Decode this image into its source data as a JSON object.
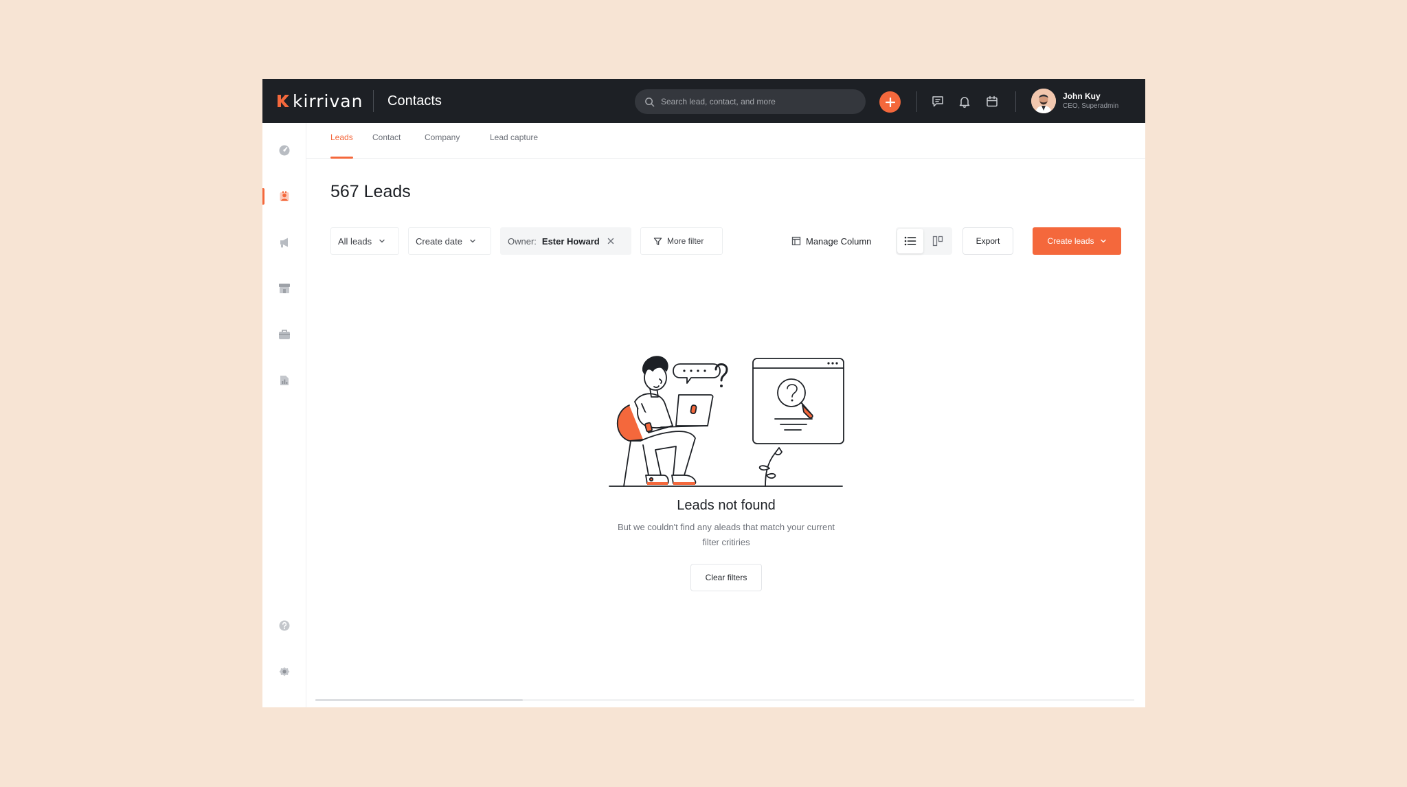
{
  "app": {
    "brand": "kirrivan",
    "page_title": "Contacts"
  },
  "search": {
    "placeholder": "Search lead, contact, and more"
  },
  "user": {
    "name": "John Kuy",
    "role": "CEO, Superadmin"
  },
  "tabs": [
    {
      "label": "Leads",
      "active": true
    },
    {
      "label": "Contact",
      "active": false
    },
    {
      "label": "Company",
      "active": false
    },
    {
      "label": "Lead capture",
      "active": false
    }
  ],
  "leads": {
    "title": "567 Leads"
  },
  "filters": {
    "all_leads": "All leads",
    "create_date": "Create date",
    "owner_label": "Owner:",
    "owner_value": "Ester Howard",
    "more_filter": "More filter"
  },
  "toolbar": {
    "manage_column": "Manage Column",
    "export": "Export",
    "create_leads": "Create leads"
  },
  "empty_state": {
    "title": "Leads not found",
    "description": "But we couldn't find any aleads that match your current filter critiries",
    "clear_filters": "Clear filters"
  },
  "colors": {
    "accent": "#f4683c",
    "topbar": "#1d2025",
    "background": "#f7e4d4"
  },
  "icons": {
    "sidebar": [
      "dashboard-icon",
      "contacts-icon",
      "campaign-icon",
      "store-icon",
      "briefcase-icon",
      "reports-icon",
      "help-icon",
      "settings-icon"
    ],
    "topbar": [
      "search-icon",
      "plus-icon",
      "chat-icon",
      "bell-icon",
      "calendar-icon"
    ]
  }
}
